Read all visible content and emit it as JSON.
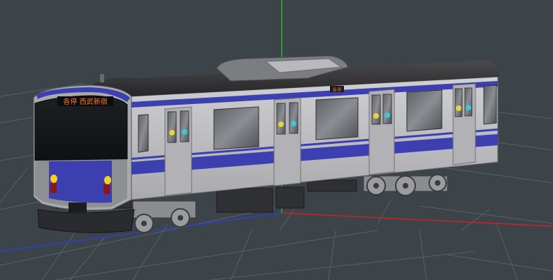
{
  "viewport": {
    "background_color": "#3d4449",
    "grid_color": "#6e7a82",
    "axes": {
      "x_color": "#d62020",
      "y_color": "#22c022",
      "z_color": "#2a3fd6"
    }
  },
  "model": {
    "body_color": "#c4c4c8",
    "roof_color": "#3a3a3c",
    "stripe_color": "#3b3fb0",
    "headlight_color": "#f2d21a",
    "destination_sign": {
      "text": "各停 西武新宿",
      "color": "#ff7a2a"
    },
    "side_indicator": {
      "text": "各停",
      "color": "#ff7a2a"
    }
  }
}
